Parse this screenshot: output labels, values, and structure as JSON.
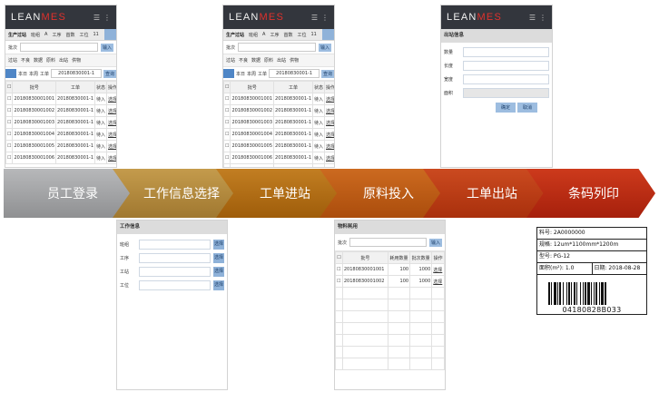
{
  "brand": {
    "lean": "LEAN",
    "mes": "MES"
  },
  "flow_steps": [
    "员工登录",
    "工作信息选择",
    "工单进站",
    "原料投入",
    "工单出站",
    "条码列印"
  ],
  "step_colors": [
    "#a4a5a7",
    "#b48b3c",
    "#b06b12",
    "#bb5a12",
    "#b93b12",
    "#b82a14"
  ],
  "screen1": {
    "tabs": [
      "生产过站",
      "班组",
      "A",
      "工序",
      "首数",
      "工位",
      "11"
    ],
    "batch_label": "批次",
    "input_btn": "输入",
    "categories": [
      "过站",
      "不良",
      "数据",
      "原料",
      "出站",
      "供物"
    ],
    "date_btns": [
      "全日",
      "本日",
      "本周",
      "工单"
    ],
    "wo_value": "20180830001-1",
    "query_btn": "查询",
    "table_headers": [
      "批号",
      "工单",
      "状态",
      "操作"
    ],
    "rows": [
      [
        "20180830001001",
        "20180830001-1",
        "待入",
        "选择"
      ],
      [
        "20180830001002",
        "20180830001-1",
        "待入",
        "选择"
      ],
      [
        "20180830001003",
        "20180830001-1",
        "待入",
        "选择"
      ],
      [
        "20180830001004",
        "20180830001-1",
        "待入",
        "选择"
      ],
      [
        "20180830001005",
        "20180830001-1",
        "待入",
        "选择"
      ],
      [
        "20180830001006",
        "20180830001-1",
        "待入",
        "选择"
      ]
    ]
  },
  "screen2": {
    "tabs": [
      "生产过站",
      "班组",
      "A",
      "工序",
      "首数",
      "工位",
      "11"
    ],
    "batch_label": "批次",
    "input_btn": "输入",
    "categories": [
      "过站",
      "不良",
      "数据",
      "原料",
      "出站",
      "供物"
    ],
    "date_btns": [
      "全日",
      "本日",
      "本周",
      "工单"
    ],
    "wo_value": "20180830001-1",
    "query_btn": "查询",
    "table_headers": [
      "批号",
      "工单",
      "状态",
      "操作"
    ],
    "rows": [
      [
        "20180830001001",
        "20180830001-1",
        "待入",
        "选择"
      ],
      [
        "20180830001002",
        "20180830001-1",
        "待入",
        "选择"
      ],
      [
        "20180830001003",
        "20180830001-1",
        "待入",
        "选择"
      ],
      [
        "20180830001004",
        "20180830001-1",
        "待入",
        "选择"
      ],
      [
        "20180830001005",
        "20180830001-1",
        "待入",
        "选择"
      ],
      [
        "20180830001006",
        "20180830001-1",
        "待入",
        "选择"
      ],
      [
        "20180830001007",
        "20180830001-1",
        "待入",
        "选择"
      ],
      [
        "20180830001008",
        "20180830001-1",
        "待入",
        "选择"
      ]
    ]
  },
  "screen3": {
    "title": "出站信息",
    "fields": [
      "数量",
      "长度",
      "宽度",
      "面积"
    ],
    "confirm": "确定",
    "cancel": "取消"
  },
  "screen4": {
    "title": "工作信息",
    "fields": [
      "班组",
      "工序",
      "工站",
      "工位"
    ],
    "btn": "选择"
  },
  "screen5": {
    "title": "物料耗用",
    "batch_label": "批次",
    "input_btn": "输入",
    "table_headers": [
      "批号",
      "耗用数量",
      "批次数量",
      "操作"
    ],
    "rows": [
      [
        "20180830001001",
        "100",
        "1000",
        "选择"
      ],
      [
        "20180830001002",
        "100",
        "1000",
        "选择"
      ]
    ]
  },
  "print_label": {
    "material": "料号: 2A0000000",
    "spec": "规格: 12um*1100mm*1200m",
    "model": "型号: PG-12",
    "area": "面积(m²): 1.0",
    "date": "日期: 2018-08-28",
    "barcode_text": "04180828B033"
  }
}
